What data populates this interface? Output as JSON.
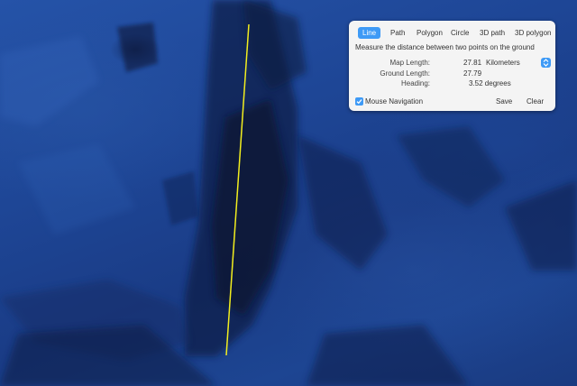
{
  "measure_panel": {
    "tabs": [
      {
        "label": "Line",
        "active": true
      },
      {
        "label": "Path",
        "active": false
      },
      {
        "label": "Polygon",
        "active": false
      },
      {
        "label": "Circle",
        "active": false
      },
      {
        "label": "3D path",
        "active": false
      },
      {
        "label": "3D polygon",
        "active": false
      }
    ],
    "description": "Measure the distance between two points on the ground",
    "map_length_label": "Map Length:",
    "map_length_value": "27.81",
    "unit": "Kilometers",
    "ground_length_label": "Ground Length:",
    "ground_length_value": "27.79",
    "heading_label": "Heading:",
    "heading_value": "3.52 degrees",
    "mouse_navigation_label": "Mouse Navigation",
    "mouse_navigation_checked": true,
    "save_label": "Save",
    "clear_label": "Clear"
  },
  "colors": {
    "accent": "#3e9af6",
    "measure_line": "#f2ee1e",
    "ocean": "#1e4696"
  },
  "icons": {
    "unit_stepper": "chevron-updown-icon",
    "checkbox": "checkmark-icon"
  }
}
